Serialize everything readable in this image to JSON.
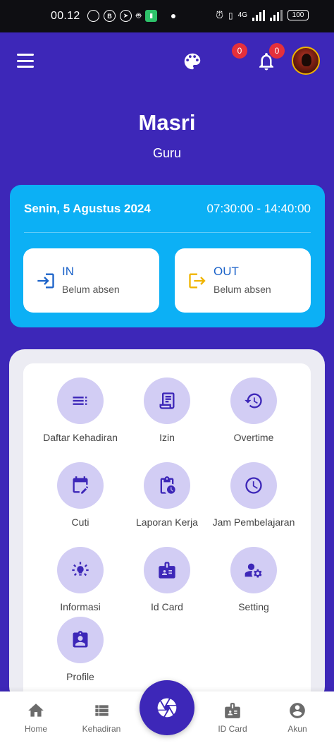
{
  "status_bar": {
    "time": "00.12",
    "network": "4G",
    "battery": "100"
  },
  "header": {
    "notification_badge_1": "0",
    "notification_badge_2": "0",
    "user_name": "Masri",
    "user_role": "Guru"
  },
  "attendance": {
    "date": "Senin, 5 Agustus 2024",
    "hours": "07:30:00 - 14:40:00",
    "in": {
      "title": "IN",
      "status": "Belum absen"
    },
    "out": {
      "title": "OUT",
      "status": "Belum absen"
    }
  },
  "menu": {
    "items": [
      {
        "label": "Daftar Kehadiran",
        "icon": "list-icon"
      },
      {
        "label": "Izin",
        "icon": "receipt-icon"
      },
      {
        "label": "Overtime",
        "icon": "clock-restore-icon"
      },
      {
        "label": "Cuti",
        "icon": "calendar-edit-icon"
      },
      {
        "label": "Laporan Kerja",
        "icon": "clipboard-clock-icon"
      },
      {
        "label": "Jam Pembelajaran",
        "icon": "clock-icon"
      },
      {
        "label": "Informasi",
        "icon": "lightbulb-icon"
      },
      {
        "label": "Id Card",
        "icon": "badge-icon"
      },
      {
        "label": "Setting",
        "icon": "user-gear-icon"
      },
      {
        "label": "Profile",
        "icon": "account-box-icon"
      }
    ]
  },
  "bottom_nav": {
    "items": [
      {
        "label": "Home",
        "icon": "home-icon"
      },
      {
        "label": "Kehadiran",
        "icon": "list-icon"
      },
      {
        "label": "ID Card",
        "icon": "badge-icon"
      },
      {
        "label": "Akun",
        "icon": "account-circle-icon"
      }
    ],
    "center_action_icon": "camera-shutter-icon"
  },
  "colors": {
    "primary": "#3d27b8",
    "card": "#0cb0f5",
    "icon_circle": "#d2cdf4",
    "badge": "#e5303b",
    "out_icon": "#f0b400"
  }
}
